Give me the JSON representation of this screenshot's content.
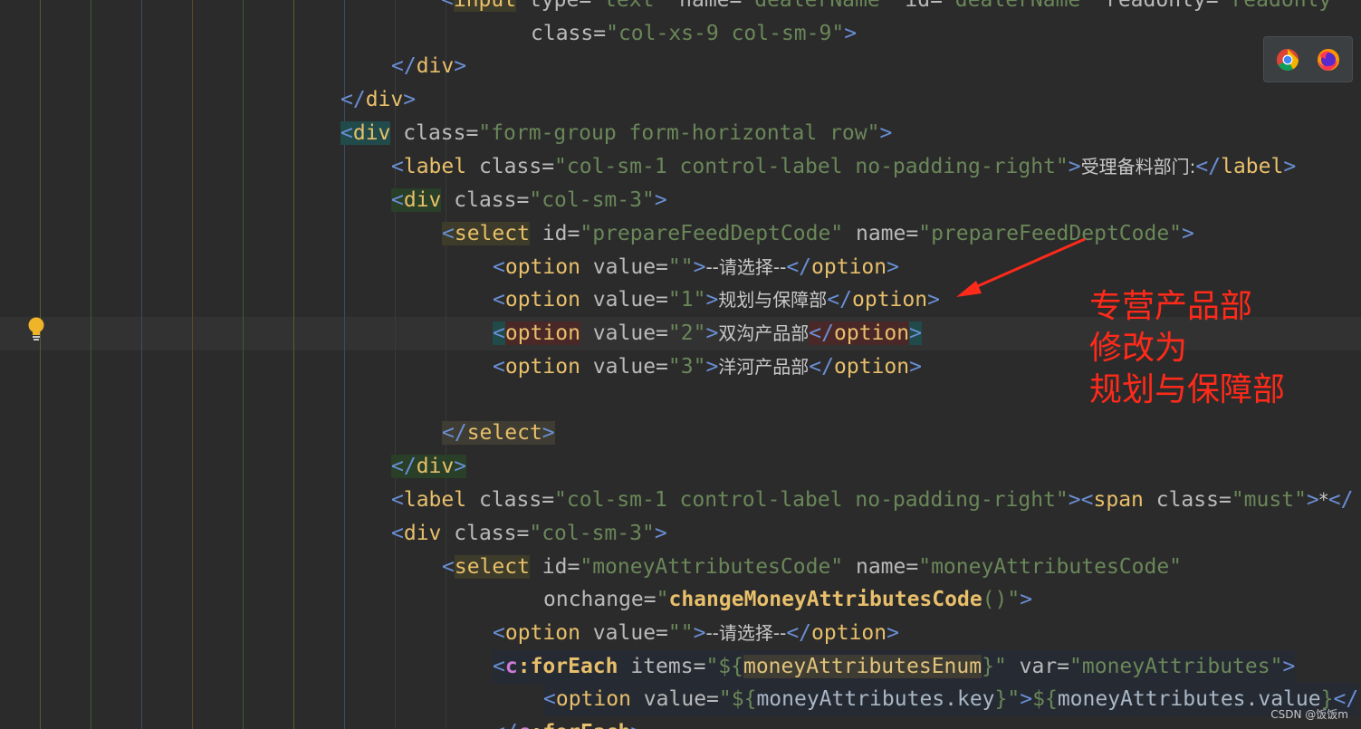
{
  "editor": {
    "lines": [
      [
        [
          "br",
          "<"
        ],
        [
          "tag",
          "input"
        ],
        [
          "attr",
          " type="
        ],
        [
          "val",
          "\"text\""
        ],
        [
          "attr",
          " name="
        ],
        [
          "val",
          "\"dealerName\""
        ],
        [
          "attr",
          " id="
        ],
        [
          "val",
          "\"dealerName\""
        ],
        [
          "attr",
          " readonly="
        ],
        [
          "val",
          "\"readonly\""
        ]
      ],
      [
        [
          "attr",
          "class="
        ],
        [
          "val",
          "\"col-xs-9 col-sm-9\""
        ],
        [
          "br",
          ">"
        ]
      ],
      [
        [
          "br",
          "</"
        ],
        [
          "tag",
          "div"
        ],
        [
          "br",
          ">"
        ]
      ],
      [
        [
          "br",
          "</"
        ],
        [
          "tag",
          "div"
        ],
        [
          "br",
          ">"
        ]
      ],
      [
        [
          "br",
          "<"
        ],
        [
          "tag",
          "div"
        ],
        [
          "attr",
          " class="
        ],
        [
          "val",
          "\"form-group form-horizontal row\""
        ],
        [
          "br",
          ">"
        ]
      ],
      [
        [
          "br",
          "<"
        ],
        [
          "tag",
          "label"
        ],
        [
          "attr",
          " class="
        ],
        [
          "val",
          "\"col-sm-1 control-label no-padding-right\""
        ],
        [
          "br",
          ">"
        ],
        [
          "txt",
          "受理备料部门:"
        ],
        [
          "br",
          "</"
        ],
        [
          "tag",
          "label"
        ],
        [
          "br",
          ">"
        ]
      ],
      [
        [
          "br",
          "<"
        ],
        [
          "tag",
          "div"
        ],
        [
          "attr",
          " class="
        ],
        [
          "val",
          "\"col-sm-3\""
        ],
        [
          "br",
          ">"
        ]
      ],
      [
        [
          "br",
          "<"
        ],
        [
          "tag",
          "select"
        ],
        [
          "attr",
          " id="
        ],
        [
          "val",
          "\"prepareFeedDeptCode\""
        ],
        [
          "attr",
          " name="
        ],
        [
          "val",
          "\"prepareFeedDeptCode\""
        ],
        [
          "br",
          ">"
        ]
      ],
      [
        [
          "br",
          "<"
        ],
        [
          "tag",
          "option"
        ],
        [
          "attr",
          " value="
        ],
        [
          "val",
          "\"\""
        ],
        [
          "br",
          ">"
        ],
        [
          "txt",
          "--请选择--"
        ],
        [
          "br",
          "</"
        ],
        [
          "tag",
          "option"
        ],
        [
          "br",
          ">"
        ]
      ],
      [
        [
          "br",
          "<"
        ],
        [
          "tag",
          "option"
        ],
        [
          "attr",
          " value="
        ],
        [
          "val",
          "\"1\""
        ],
        [
          "br",
          ">"
        ],
        [
          "txt",
          "规划与保障部"
        ],
        [
          "br",
          "</"
        ],
        [
          "tag",
          "option"
        ],
        [
          "br",
          ">"
        ]
      ],
      [
        [
          "br",
          "<"
        ],
        [
          "tag",
          "option"
        ],
        [
          "attr",
          " value="
        ],
        [
          "val",
          "\"2\""
        ],
        [
          "br",
          ">"
        ],
        [
          "txt",
          "双沟产品部"
        ],
        [
          "br",
          "</"
        ],
        [
          "tag",
          "option"
        ],
        [
          "br",
          ">"
        ]
      ],
      [
        [
          "br",
          "<"
        ],
        [
          "tag",
          "option"
        ],
        [
          "attr",
          " value="
        ],
        [
          "val",
          "\"3\""
        ],
        [
          "br",
          ">"
        ],
        [
          "txt",
          "洋河产品部"
        ],
        [
          "br",
          "</"
        ],
        [
          "tag",
          "option"
        ],
        [
          "br",
          ">"
        ]
      ],
      [],
      [
        [
          "br",
          "</"
        ],
        [
          "tag",
          "select"
        ],
        [
          "br",
          ">"
        ]
      ],
      [
        [
          "br",
          "</"
        ],
        [
          "tag",
          "div"
        ],
        [
          "br",
          ">"
        ]
      ],
      [
        [
          "br",
          "<"
        ],
        [
          "tag",
          "label"
        ],
        [
          "attr",
          " class="
        ],
        [
          "val",
          "\"col-sm-1 control-label no-padding-right\""
        ],
        [
          "br",
          ">"
        ],
        [
          "br",
          "<"
        ],
        [
          "tag",
          "span"
        ],
        [
          "attr",
          " class="
        ],
        [
          "val",
          "\"must\""
        ],
        [
          "br",
          ">"
        ],
        [
          "txt",
          "*"
        ],
        [
          "br",
          "</"
        ]
      ],
      [
        [
          "br",
          "<"
        ],
        [
          "tag",
          "div"
        ],
        [
          "attr",
          " class="
        ],
        [
          "val",
          "\"col-sm-3\""
        ],
        [
          "br",
          ">"
        ]
      ],
      [
        [
          "br",
          "<"
        ],
        [
          "tag",
          "select"
        ],
        [
          "attr",
          " id="
        ],
        [
          "val",
          "\"moneyAttributesCode\""
        ],
        [
          "attr",
          " name="
        ],
        [
          "val",
          "\"moneyAttributesCode\""
        ]
      ],
      [
        [
          "attr",
          "onchange="
        ],
        [
          "val",
          "\""
        ],
        [
          "fn",
          "changeMoneyAttributesCode"
        ],
        [
          "val",
          "()\""
        ],
        [
          "br",
          ">"
        ]
      ],
      [
        [
          "br",
          "<"
        ],
        [
          "tag",
          "option"
        ],
        [
          "attr",
          " value="
        ],
        [
          "val",
          "\"\""
        ],
        [
          "br",
          ">"
        ],
        [
          "txt",
          "--请选择--"
        ],
        [
          "br",
          "</"
        ],
        [
          "tag",
          "option"
        ],
        [
          "br",
          ">"
        ]
      ],
      [
        [
          "br",
          "<"
        ],
        [
          "ns",
          "c"
        ],
        [
          "fn",
          ":forEach"
        ],
        [
          "attr",
          " items="
        ],
        [
          "val",
          "\"${"
        ],
        [
          "el",
          "moneyAttributesEnum"
        ],
        [
          "val",
          "}\""
        ],
        [
          "attr",
          " var="
        ],
        [
          "val",
          "\"moneyAttributes\""
        ],
        [
          "br",
          ">"
        ]
      ],
      [
        [
          "br",
          "<"
        ],
        [
          "tag",
          "option"
        ],
        [
          "attr",
          " value="
        ],
        [
          "val",
          "\"${"
        ],
        [
          "el2",
          "moneyAttributes.key"
        ],
        [
          "val",
          "}\""
        ],
        [
          "br",
          ">"
        ],
        [
          "val",
          "${"
        ],
        [
          "el2",
          "moneyAttributes.value"
        ],
        [
          "val",
          "}"
        ],
        [
          "br",
          "</"
        ]
      ],
      [
        [
          "br",
          "</"
        ],
        [
          "ns",
          "c"
        ],
        [
          "fn",
          ":forEach"
        ],
        [
          "br",
          ">"
        ]
      ]
    ]
  },
  "annotation": {
    "line1": "专营产品部",
    "line2": "修改为",
    "line3": "规划与保障部",
    "color": "#ff2a1a"
  },
  "browser_bar": {
    "icons": [
      "chrome-icon",
      "firefox-icon"
    ]
  },
  "watermark": "CSDN @饭饭m"
}
